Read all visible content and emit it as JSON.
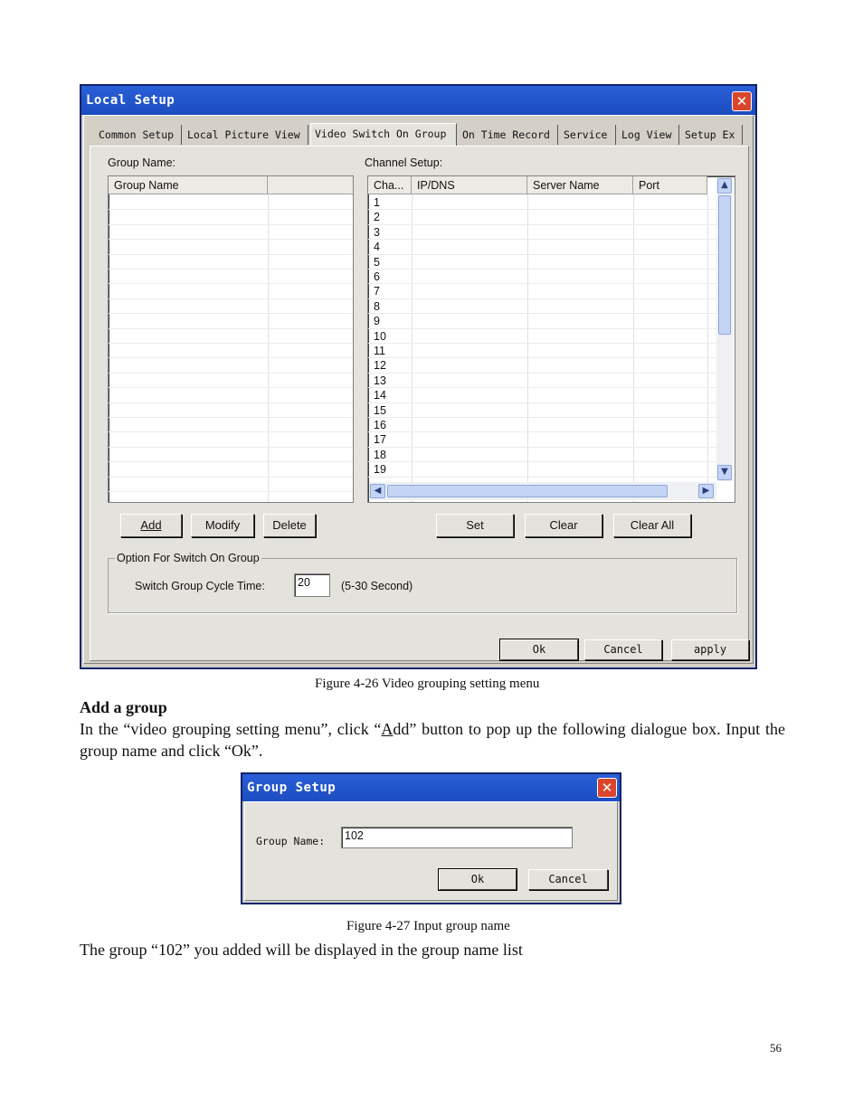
{
  "dialog1": {
    "title": "Local Setup",
    "tabs": [
      "Common Setup",
      "Local Picture View",
      "Video Switch On Group",
      "On Time Record",
      "Service",
      "Log View",
      "Setup Ex"
    ],
    "group_name_label": "Group Name:",
    "group_table_header": "Group Name",
    "channel_setup_label": "Channel Setup:",
    "channel_headers": [
      "Cha...",
      "IP/DNS",
      "Server Name",
      "Port"
    ],
    "channel_rows": [
      "1",
      "2",
      "3",
      "4",
      "5",
      "6",
      "7",
      "8",
      "9",
      "10",
      "11",
      "12",
      "13",
      "14",
      "15",
      "16",
      "17",
      "18",
      "19"
    ],
    "buttons": {
      "add": "Add",
      "modify": "Modify",
      "delete": "Delete",
      "set": "Set",
      "clear": "Clear",
      "clear_all": "Clear All"
    },
    "option_group_label": "Option For Switch On Group",
    "cycle_label": "Switch Group Cycle Time:",
    "cycle_value": "20",
    "cycle_range": "(5-30 Second)",
    "footer_buttons": {
      "ok": "Ok",
      "cancel": "Cancel",
      "apply": "apply"
    }
  },
  "caption1": "Figure 4-26 Video grouping setting menu",
  "section_heading": "Add a group",
  "paragraph": {
    "before": "In the “video grouping setting menu”, click “",
    "underlined": "A",
    "after": "dd” button to pop up the following dialogue box. Input the group name and click “Ok”."
  },
  "dialog2": {
    "title": "Group Setup",
    "group_name_label": "Group Name:",
    "group_name_value": "102",
    "ok": "Ok",
    "cancel": "Cancel"
  },
  "caption2": "Figure 4-27 Input group name",
  "closing_text": "The group “102” you added will be displayed in the group name list",
  "page_number": "56"
}
